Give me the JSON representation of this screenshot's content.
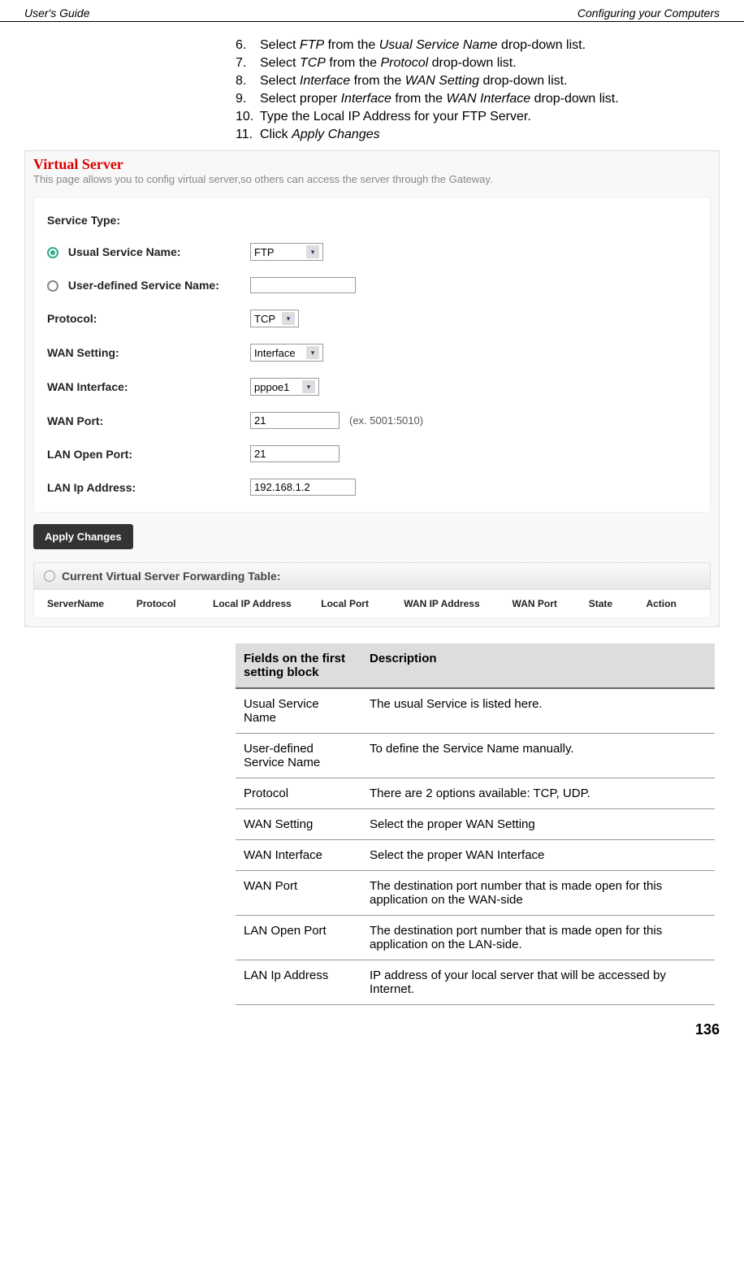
{
  "header": {
    "left": "User's Guide",
    "right": "Configuring your Computers"
  },
  "steps": [
    {
      "num": "6.",
      "pre": "Select ",
      "it1": "FTP",
      "mid": " from the ",
      "it2": "Usual Service Name",
      "post": " drop-down list."
    },
    {
      "num": "7.",
      "pre": "Select ",
      "it1": "TCP",
      "mid": " from the ",
      "it2": "Protocol",
      "post": " drop-down list."
    },
    {
      "num": "8.",
      "pre": "Select ",
      "it1": "Interface",
      "mid": " from the ",
      "it2": "WAN Setting",
      "post": " drop-down list."
    },
    {
      "num": "9.",
      "pre": "Select proper ",
      "it1": "Interface",
      "mid": " from the ",
      "it2": "WAN Interface",
      "post": " drop-down list."
    },
    {
      "num": "10.",
      "pre": "Type the Local IP Address for your FTP Server.",
      "it1": "",
      "mid": "",
      "it2": "",
      "post": ""
    },
    {
      "num": "11.",
      "pre": "Click ",
      "it1": "Apply Changes",
      "mid": "",
      "it2": "",
      "post": ""
    }
  ],
  "vs": {
    "title": "Virtual Server",
    "subtitle": "This page allows you to config virtual server,so others can access the server through the Gateway.",
    "serviceTypeLabel": "Service Type:",
    "usualLabel": "Usual Service Name:",
    "userDefLabel": "User-defined Service Name:",
    "protocolLabel": "Protocol:",
    "wanSettingLabel": "WAN Setting:",
    "wanInterfaceLabel": "WAN Interface:",
    "wanPortLabel": "WAN Port:",
    "lanOpenPortLabel": "LAN Open Port:",
    "lanIpLabel": "LAN Ip Address:",
    "usualValue": "FTP",
    "userDefValue": "",
    "protocolValue": "TCP",
    "wanSettingValue": "Interface",
    "wanInterfaceValue": "pppoe1",
    "wanPortValue": "21",
    "wanPortHint": "(ex. 5001:5010)",
    "lanOpenPortValue": "21",
    "lanIpValue": "192.168.1.2",
    "applyLabel": "Apply Changes",
    "tableTitle": "Current Virtual Server Forwarding Table:",
    "cols": [
      "ServerName",
      "Protocol",
      "Local IP Address",
      "Local Port",
      "WAN IP Address",
      "WAN Port",
      "State",
      "Action"
    ]
  },
  "table": {
    "h1": "Fields on the first setting block",
    "h2": "Description",
    "rows": [
      {
        "f": "Usual Service Name",
        "d": "The usual Service is listed here."
      },
      {
        "f": "User-defined Service Name",
        "d": "To define the Service Name manually."
      },
      {
        "f": "Protocol",
        "d": "There are 2 options available: TCP, UDP."
      },
      {
        "f": "WAN Setting",
        "d": "Select the proper WAN Setting"
      },
      {
        "f": "WAN Interface",
        "d": "Select the proper  WAN Interface"
      },
      {
        "f": "WAN Port",
        "d": "The destination port number that is made open for this application on the WAN-side"
      },
      {
        "f": "LAN Open Port",
        "d": "The destination port number that is made open for this application on the LAN-side."
      },
      {
        "f": "LAN Ip Address",
        "d": "IP address of your local server that will be accessed by Internet."
      }
    ]
  },
  "pageNum": "136"
}
